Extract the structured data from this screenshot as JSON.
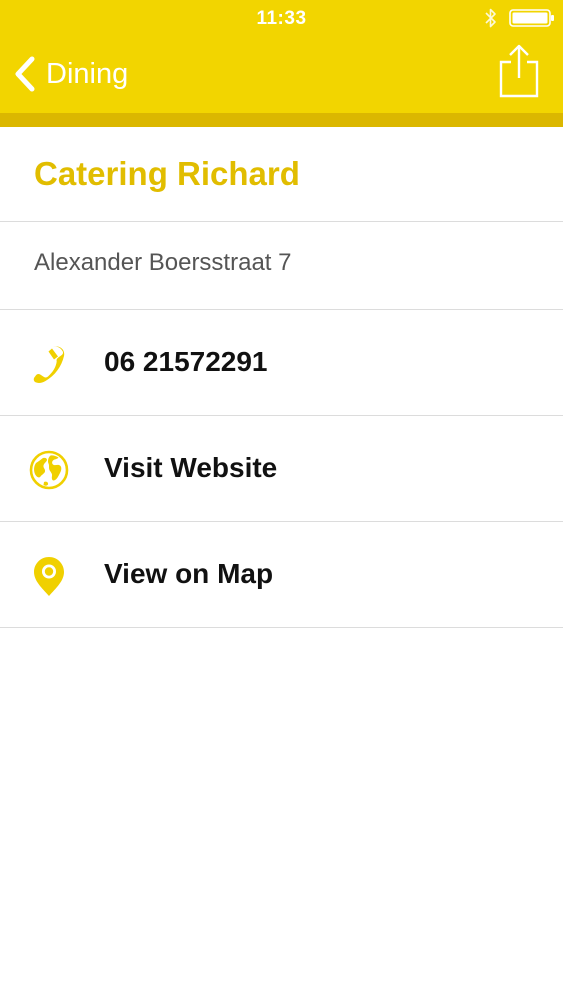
{
  "status_bar": {
    "time": "11:33"
  },
  "nav": {
    "back_label": "Dining",
    "back_icon": "chevron-left-icon",
    "share_icon": "share-icon"
  },
  "detail": {
    "title": "Catering Richard",
    "address": "Alexander Boersstraat 7",
    "actions": [
      {
        "icon": "phone-icon",
        "label": "06 21572291"
      },
      {
        "icon": "globe-icon",
        "label": "Visit Website"
      },
      {
        "icon": "map-pin-icon",
        "label": "View on Map"
      }
    ]
  },
  "colors": {
    "accent": "#f2d500",
    "accent_dark": "#dbb700",
    "title": "#e1bd00",
    "icon": "#f0d000"
  }
}
